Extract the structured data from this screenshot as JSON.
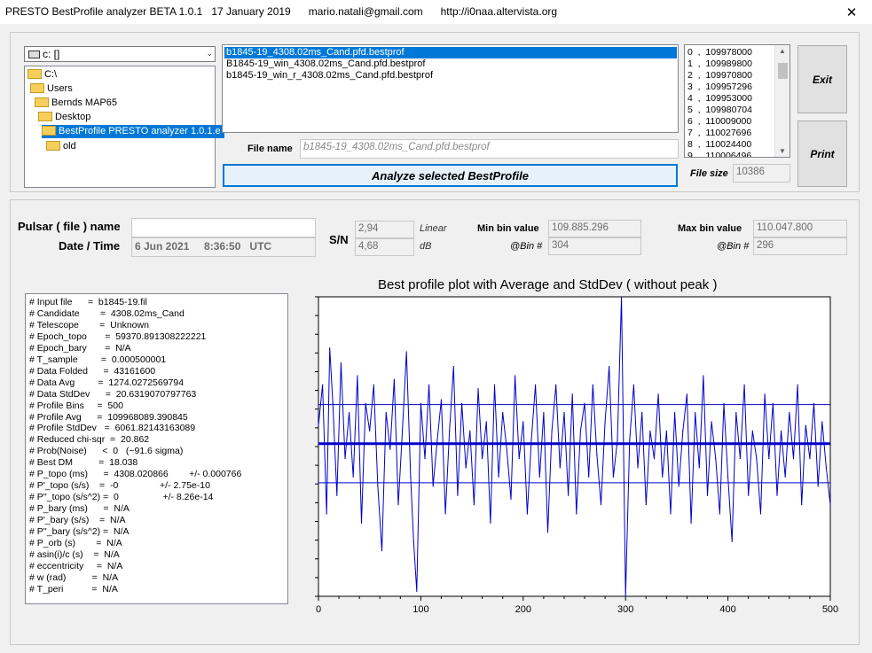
{
  "window": {
    "title": "PRESTO BestProfile analyzer BETA 1.0.1   17 January 2019      mario.natali@gmail.com      http://i0naa.altervista.org",
    "close_glyph": "✕"
  },
  "drive": {
    "label": "c: []",
    "arrow_glyph": "⌄"
  },
  "dirs": [
    {
      "label": "C:\\"
    },
    {
      "label": "Users"
    },
    {
      "label": "Bernds MAP65"
    },
    {
      "label": "Desktop"
    },
    {
      "label": "BestProfile PRESTO analyzer 1.0.1.e"
    },
    {
      "label": "old"
    }
  ],
  "files": [
    {
      "name": "b1845-19_4308.02ms_Cand.pfd.bestprof",
      "selected": true
    },
    {
      "name": "B1845-19_win_4308.02ms_Cand.pfd.bestprof",
      "selected": false
    },
    {
      "name": "b1845-19_win_r_4308.02ms_Cand.pfd.bestprof",
      "selected": false
    }
  ],
  "values_list": [
    "0  ,  109978000",
    "1  ,  109989800",
    "2  ,  109970800",
    "3  ,  109957296",
    "4  ,  109953000",
    "5  ,  109980704",
    "6  ,  110009000",
    "7  ,  110027696",
    "8  ,  110024400",
    "9  ,  110006496"
  ],
  "buttons": {
    "exit": "Exit",
    "print": "Print",
    "analyze": "Analyze selected BestProfile"
  },
  "file_name": {
    "label": "File name",
    "value": "b1845-19_4308.02ms_Cand.pfd.bestprof"
  },
  "file_size": {
    "label": "File size",
    "value": "10386"
  },
  "pulsar": {
    "label": "Pulsar ( file ) name",
    "value": ""
  },
  "datetime": {
    "label": "Date / Time",
    "value": "6 Jun 2021     8:36:50   UTC"
  },
  "sn": {
    "label": "S/N",
    "linear_value": "2,94",
    "linear_label": "Linear",
    "db_value": "4,68",
    "db_label": "dB"
  },
  "min_bin": {
    "label": "Min bin value",
    "value": "109.885.296",
    "bin_label": "@Bin #",
    "bin": "304"
  },
  "max_bin": {
    "label": "Max bin value",
    "value": "110.047.800",
    "bin_label": "@Bin #",
    "bin": "296"
  },
  "info_lines": [
    "# Input file      =  b1845-19.fil",
    "# Candidate        =  4308.02ms_Cand",
    "# Telescope        =  Unknown",
    "# Epoch_topo       =  59370.891308222221",
    "# Epoch_bary       =  N/A",
    "# T_sample         =  0.000500001",
    "# Data Folded      =  43161600",
    "# Data Avg         =  1274.0272569794",
    "# Data StdDev      =  20.6319070797763",
    "# Profile Bins     =  500",
    "# Profile Avg      =  109968089.390845",
    "# Profile StdDev   =  6061.82143163089",
    "# Reduced chi-sqr  =  20.862",
    "# Prob(Noise)      <  0   (~91.6 sigma)",
    "# Best DM          =  18.038",
    "# P_topo (ms)      =  4308.020866        +/- 0.000766",
    "# P'_topo (s/s)    =  -0                +/- 2.75e-10",
    "# P''_topo (s/s^2) =  0                 +/- 8.26e-14",
    "# P_bary (ms)      =  N/A",
    "# P'_bary (s/s)    =  N/A",
    "# P''_bary (s/s^2) =  N/A",
    "# P_orb (s)        =  N/A",
    "# asin(i)/c (s)    =  N/A",
    "# eccentricity     =  N/A",
    "# w (rad)          =  N/A",
    "# T_peri           =  N/A"
  ],
  "chart_data": {
    "type": "line",
    "title": "Best profile plot with  Average and StdDev ( without peak )",
    "xlim": [
      0,
      500
    ],
    "ylim": [
      109885296,
      110047800
    ],
    "xticks": [
      0,
      100,
      200,
      300,
      400,
      500
    ],
    "avg": 109968089,
    "stddev": 6061.8,
    "color": "#0000c8",
    "series": [
      {
        "x": [
          0,
          4,
          8,
          11,
          14,
          18,
          22,
          26,
          30,
          34,
          38,
          42,
          46,
          50,
          54,
          58,
          62,
          66,
          70,
          74,
          78,
          82,
          86,
          90,
          93,
          96,
          100,
          104,
          108,
          112,
          116,
          120,
          124,
          128,
          132,
          136,
          140,
          144,
          148,
          152,
          156,
          160,
          164,
          168,
          172,
          176,
          180,
          184,
          188,
          192,
          196,
          200,
          204,
          208,
          212,
          216,
          220,
          224,
          228,
          232,
          236,
          240,
          244,
          248,
          252,
          256,
          260,
          264,
          268,
          272,
          276,
          280,
          284,
          288,
          292,
          296,
          300,
          304,
          308,
          312,
          316,
          320,
          324,
          328,
          332,
          336,
          340,
          344,
          348,
          352,
          356,
          360,
          364,
          368,
          372,
          376,
          380,
          384,
          388,
          392,
          396,
          400,
          404,
          408,
          412,
          416,
          420,
          424,
          428,
          432,
          436,
          440,
          444,
          448,
          452,
          456,
          460,
          464,
          468,
          472,
          476,
          480,
          484,
          488,
          492,
          496,
          500
        ],
        "y": [
          109978000,
          110000000,
          109930000,
          110020000,
          109990000,
          109940000,
          110012000,
          109960000,
          109985000,
          109950000,
          110005000,
          109925000,
          109990000,
          109975000,
          110000000,
          109945000,
          109910000,
          109985000,
          109965000,
          110003000,
          109935000,
          109975000,
          110018000,
          109950000,
          109915000,
          109888000,
          109990000,
          109960000,
          110000000,
          109945000,
          109970000,
          109992000,
          109930000,
          109975000,
          110010000,
          109940000,
          109990000,
          109955000,
          109975000,
          109935000,
          109998000,
          109960000,
          109980000,
          109925000,
          110000000,
          109950000,
          109985000,
          109965000,
          109938000,
          110005000,
          109960000,
          109980000,
          109930000,
          109970000,
          110000000,
          109950000,
          109985000,
          109920000,
          109975000,
          110000000,
          109955000,
          109985000,
          109940000,
          109995000,
          109930000,
          109975000,
          109990000,
          109950000,
          110000000,
          109962000,
          109935000,
          109980000,
          110010000,
          109950000,
          109970000,
          110047800,
          109885296,
          109970000,
          110000000,
          109955000,
          109985000,
          109935000,
          109975000,
          109960000,
          109995000,
          109950000,
          109975000,
          109930000,
          109985000,
          109945000,
          109975000,
          109995000,
          109925000,
          109985000,
          109955000,
          110005000,
          109940000,
          109980000,
          109960000,
          109930000,
          109990000,
          109950000,
          109915000,
          109985000,
          109960000,
          110000000,
          109940000,
          109975000,
          109960000,
          109930000,
          109995000,
          109960000,
          109990000,
          109940000,
          109975000,
          109950000,
          109985000,
          109960000,
          110000000,
          109935000,
          109978000,
          109960000,
          109990000,
          109945000,
          109980000,
          109955000,
          109935000
        ]
      }
    ]
  }
}
